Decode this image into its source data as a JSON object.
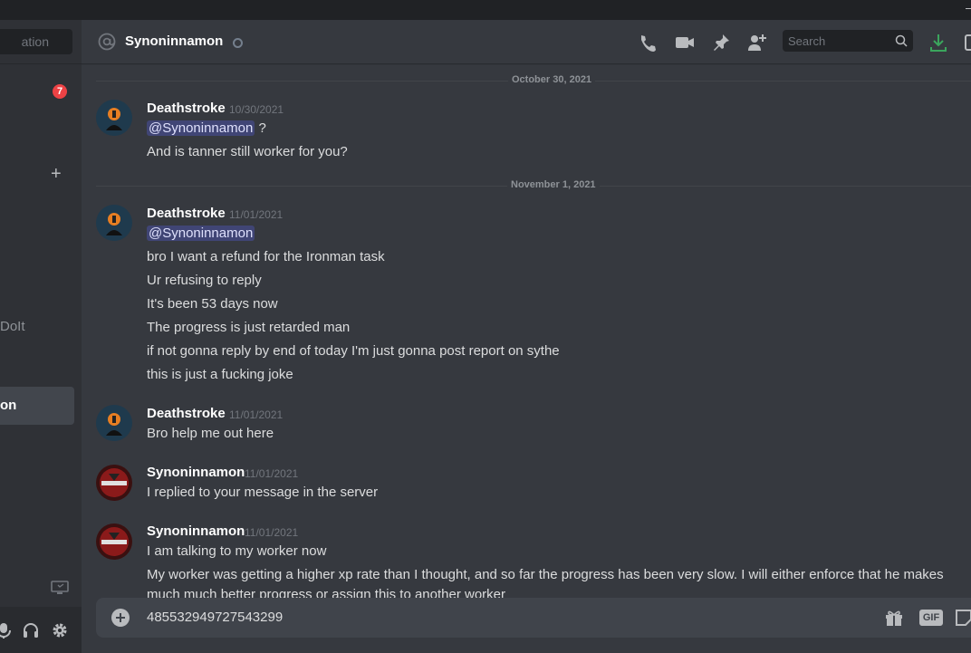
{
  "sidebar": {
    "search_placeholder": "ation",
    "unread_count": "7",
    "add_symbol": "+",
    "dm_dolt": "DoIt",
    "dm_active": "on"
  },
  "header": {
    "channel_name": "Synoninnamon",
    "search_placeholder": "Search"
  },
  "dividers": [
    "October 30, 2021",
    "November 1, 2021"
  ],
  "messages": [
    {
      "author": "Deathstroke",
      "timestamp": "10/30/2021",
      "mention": "@Synoninnamon",
      "mention_suffix": " ?",
      "lines": [
        "And is tanner still worker for you?"
      ]
    },
    {
      "author": "Deathstroke",
      "timestamp": "11/01/2021",
      "mention": "@Synoninnamon",
      "lines": [
        "bro I want a refund for the Ironman task",
        "Ur refusing to reply",
        "It's been 53 days now",
        "The progress is just retarded man",
        "if not gonna reply by end of today I'm just gonna post report on sythe",
        "this is just a fucking joke"
      ]
    },
    {
      "author": "Deathstroke",
      "timestamp": "11/01/2021",
      "lines": [
        "Bro help me out here"
      ]
    },
    {
      "author": "Synoninnamon",
      "timestamp": "11/01/2021",
      "lines": [
        "I replied to your message in the server"
      ]
    },
    {
      "author": "Synoninnamon",
      "timestamp": "11/01/2021",
      "lines": [
        "I am talking to my worker now",
        "My worker was getting a higher xp rate than I thought, and so far the progress has been very slow. I will either enforce that he makes",
        "much much better progress or assign this to another worker"
      ]
    }
  ],
  "composer": {
    "value": "485532949727543299",
    "gif_label": "GIF"
  },
  "colors": {
    "mention_bg": "#414775",
    "badge": "#ed4245",
    "download": "#3ba55d"
  }
}
